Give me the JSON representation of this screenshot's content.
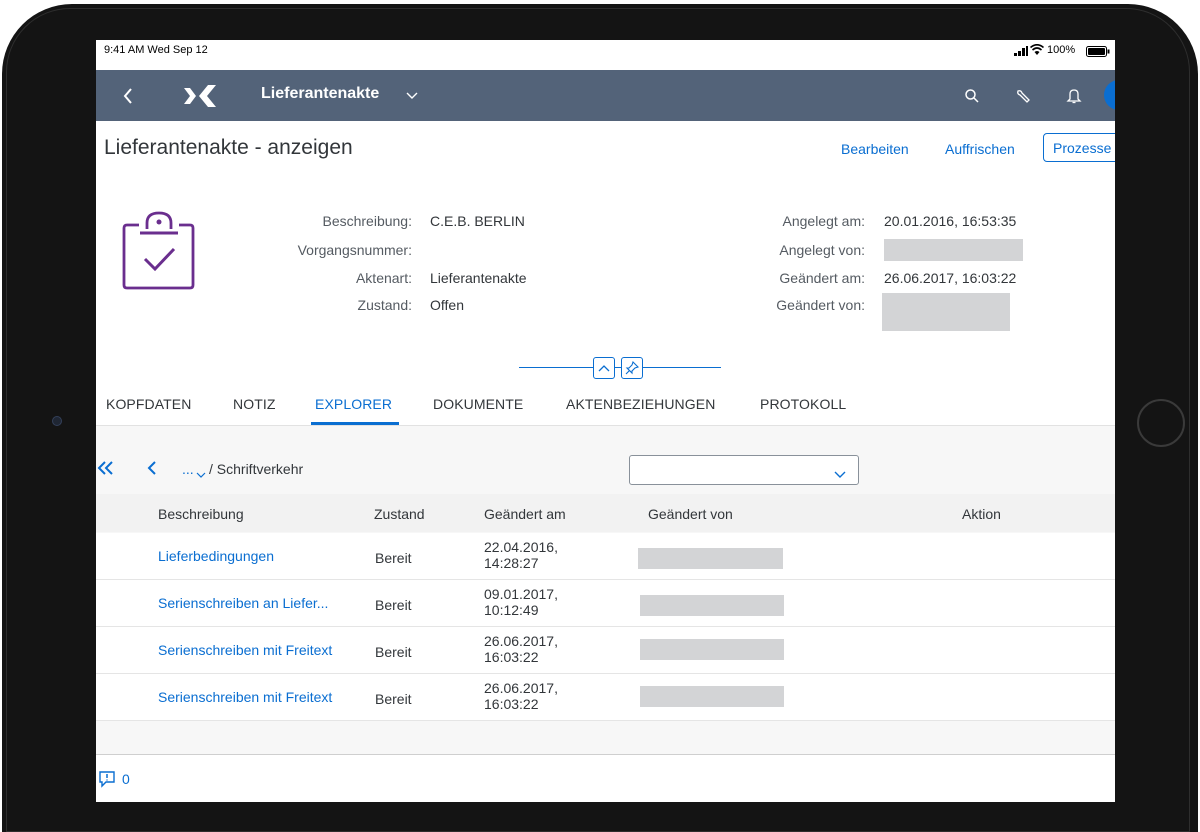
{
  "status_bar": {
    "time_date": "9:41 AM  Wed Sep 12",
    "battery": "100%"
  },
  "shell": {
    "app_title": "Lieferantenakte"
  },
  "header": {
    "title": "Lieferantenakte - anzeigen",
    "actions": {
      "edit": "Bearbeiten",
      "refresh": "Auffrischen",
      "process": "Prozesse"
    },
    "fields_left": [
      {
        "label": "Beschreibung:",
        "value": "C.E.B. BERLIN"
      },
      {
        "label": "Vorgangsnummer:",
        "value": ""
      },
      {
        "label": "Aktenart:",
        "value": "Lieferantenakte"
      },
      {
        "label": "Zustand:",
        "value": "Offen"
      }
    ],
    "fields_right": [
      {
        "label": "Angelegt am:",
        "value": "20.01.2016, 16:53:35"
      },
      {
        "label": "Angelegt von:",
        "value": ""
      },
      {
        "label": "Geändert am:",
        "value": "26.06.2017, 16:03:22"
      },
      {
        "label": "Geändert von:",
        "value": ""
      }
    ]
  },
  "tabs": [
    "KOPFDATEN",
    "NOTIZ",
    "EXPLORER",
    "DOKUMENTE",
    "AKTENBEZIEHUNGEN",
    "PROTOKOLL"
  ],
  "active_tab": "EXPLORER",
  "explorer": {
    "breadcrumb_more": "...",
    "breadcrumb_current": "/ Schriftverkehr",
    "select_value": "",
    "columns": [
      "Beschreibung",
      "Zustand",
      "Geändert am",
      "Geändert von",
      "Aktion"
    ],
    "rows": [
      {
        "description": "Lieferbedingungen",
        "state": "Bereit",
        "changed_date": "22.04.2016,",
        "changed_time": "14:28:27"
      },
      {
        "description": "Serienschreiben an Liefer...",
        "state": "Bereit",
        "changed_date": "09.01.2017,",
        "changed_time": "10:12:49"
      },
      {
        "description": "Serienschreiben mit Freitext",
        "state": "Bereit",
        "changed_date": "26.06.2017,",
        "changed_time": "16:03:22"
      },
      {
        "description": "Serienschreiben mit Freitext",
        "state": "Bereit",
        "changed_date": "26.06.2017,",
        "changed_time": "16:03:22"
      }
    ]
  },
  "footer": {
    "message_count": "0"
  },
  "colors": {
    "shell_bar": "#536379",
    "link": "#0a6ed1",
    "icon_purple": "#6a2e8e",
    "avatar": "#0a6ed1"
  }
}
